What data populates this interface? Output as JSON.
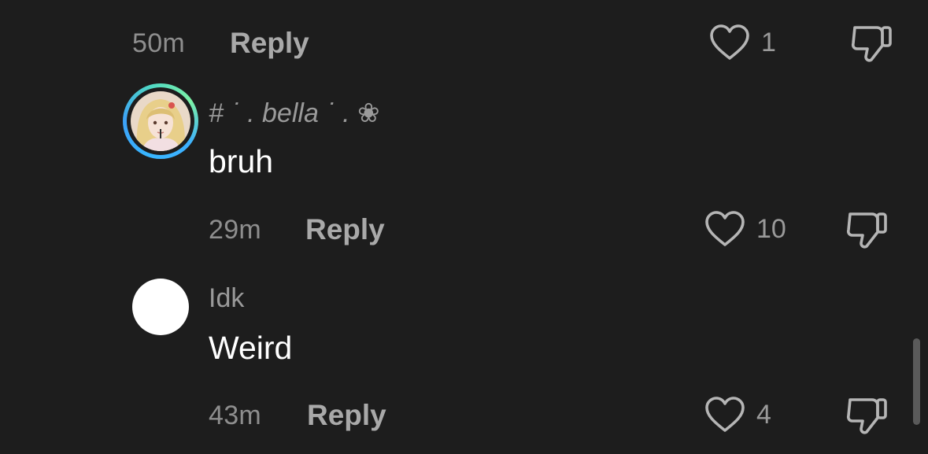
{
  "comments": [
    {
      "time": "50m",
      "reply_label": "Reply",
      "likes": "1"
    },
    {
      "username": "# ˙ . bella ˙ . ❀",
      "text": "bruh",
      "time": "29m",
      "reply_label": "Reply",
      "likes": "10"
    },
    {
      "username": "Idk",
      "text": "Weird",
      "time": "43m",
      "reply_label": "Reply",
      "likes": "4"
    }
  ],
  "icons": {
    "like": "heart-outline-icon",
    "dislike": "thumbs-down-outline-icon"
  },
  "colors": {
    "background": "#1d1d1d",
    "comment_text": "#ffffff",
    "secondary_text": "#9a9a9a",
    "avatar_ring_start": "#38b6ff",
    "avatar_ring_end": "#7cf2a6"
  }
}
